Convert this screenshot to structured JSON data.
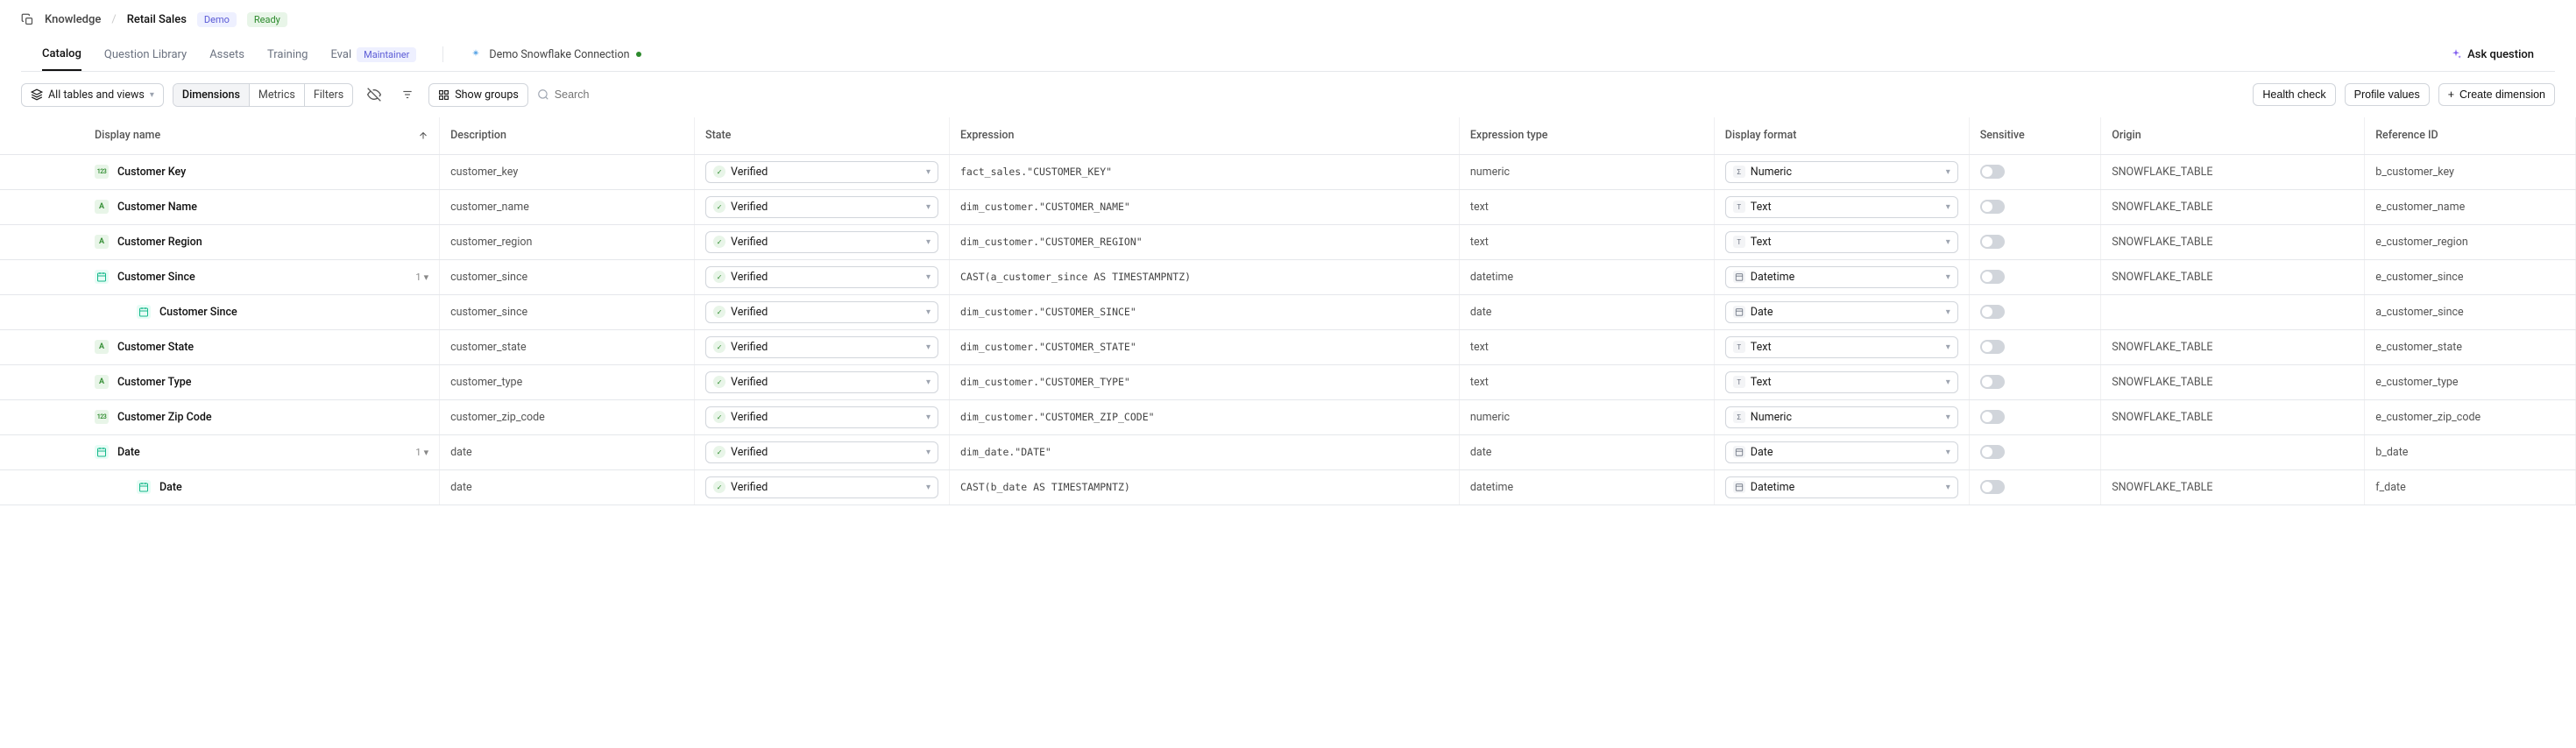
{
  "breadcrumb": {
    "root": "Knowledge",
    "current": "Retail Sales"
  },
  "badges": {
    "demo": "Demo",
    "ready": "Ready",
    "maintainer": "Maintainer"
  },
  "tabs": {
    "catalog": "Catalog",
    "question_library": "Question Library",
    "assets": "Assets",
    "training": "Training",
    "eval": "Eval"
  },
  "connection": {
    "label": "Demo Snowflake Connection"
  },
  "ask": {
    "label": "Ask question"
  },
  "toolbar": {
    "scope": "All tables and views",
    "seg": {
      "dimensions": "Dimensions",
      "metrics": "Metrics",
      "filters": "Filters"
    },
    "show_groups": "Show groups",
    "search_placeholder": "Search",
    "health_check": "Health check",
    "profile_values": "Profile values",
    "create_dimension": "Create dimension"
  },
  "columns": {
    "display_name": "Display name",
    "description": "Description",
    "state": "State",
    "expression": "Expression",
    "expression_type": "Expression type",
    "display_format": "Display format",
    "sensitive": "Sensitive",
    "origin": "Origin",
    "reference_id": "Reference ID"
  },
  "state_label": "Verified",
  "rows": [
    {
      "icon": "123",
      "indent": 0,
      "name": "Customer Key",
      "children": null,
      "desc": "customer_key",
      "expr": "fact_sales.\"CUSTOMER_KEY\"",
      "type": "numeric",
      "fmt_icon": "Σ",
      "fmt": "Numeric",
      "origin": "SNOWFLAKE_TABLE",
      "ref": "b_customer_key"
    },
    {
      "icon": "A",
      "indent": 0,
      "name": "Customer Name",
      "children": null,
      "desc": "customer_name",
      "expr": "dim_customer.\"CUSTOMER_NAME\"",
      "type": "text",
      "fmt_icon": "T",
      "fmt": "Text",
      "origin": "SNOWFLAKE_TABLE",
      "ref": "e_customer_name"
    },
    {
      "icon": "A",
      "indent": 0,
      "name": "Customer Region",
      "children": null,
      "desc": "customer_region",
      "expr": "dim_customer.\"CUSTOMER_REGION\"",
      "type": "text",
      "fmt_icon": "T",
      "fmt": "Text",
      "origin": "SNOWFLAKE_TABLE",
      "ref": "e_customer_region"
    },
    {
      "icon": "cal",
      "indent": 0,
      "name": "Customer Since",
      "children": "1",
      "desc": "customer_since",
      "expr": "CAST(a_customer_since AS TIMESTAMPNTZ)",
      "type": "datetime",
      "fmt_icon": "📅",
      "fmt": "Datetime",
      "origin": "SNOWFLAKE_TABLE",
      "ref": "e_customer_since"
    },
    {
      "icon": "cal",
      "indent": 1,
      "name": "Customer Since",
      "children": null,
      "desc": "customer_since",
      "expr": "dim_customer.\"CUSTOMER_SINCE\"",
      "type": "date",
      "fmt_icon": "📅",
      "fmt": "Date",
      "origin": "",
      "ref": "a_customer_since"
    },
    {
      "icon": "A",
      "indent": 0,
      "name": "Customer State",
      "children": null,
      "desc": "customer_state",
      "expr": "dim_customer.\"CUSTOMER_STATE\"",
      "type": "text",
      "fmt_icon": "T",
      "fmt": "Text",
      "origin": "SNOWFLAKE_TABLE",
      "ref": "e_customer_state"
    },
    {
      "icon": "A",
      "indent": 0,
      "name": "Customer Type",
      "children": null,
      "desc": "customer_type",
      "expr": "dim_customer.\"CUSTOMER_TYPE\"",
      "type": "text",
      "fmt_icon": "T",
      "fmt": "Text",
      "origin": "SNOWFLAKE_TABLE",
      "ref": "e_customer_type"
    },
    {
      "icon": "123",
      "indent": 0,
      "name": "Customer Zip Code",
      "children": null,
      "desc": "customer_zip_code",
      "expr": "dim_customer.\"CUSTOMER_ZIP_CODE\"",
      "type": "numeric",
      "fmt_icon": "Σ",
      "fmt": "Numeric",
      "origin": "SNOWFLAKE_TABLE",
      "ref": "e_customer_zip_code"
    },
    {
      "icon": "cal",
      "indent": 0,
      "name": "Date",
      "children": "1",
      "desc": "date",
      "expr": "dim_date.\"DATE\"",
      "type": "date",
      "fmt_icon": "📅",
      "fmt": "Date",
      "origin": "",
      "ref": "b_date"
    },
    {
      "icon": "cal",
      "indent": 1,
      "name": "Date",
      "children": null,
      "desc": "date",
      "expr": "CAST(b_date AS TIMESTAMPNTZ)",
      "type": "datetime",
      "fmt_icon": "📅",
      "fmt": "Datetime",
      "origin": "SNOWFLAKE_TABLE",
      "ref": "f_date"
    }
  ]
}
